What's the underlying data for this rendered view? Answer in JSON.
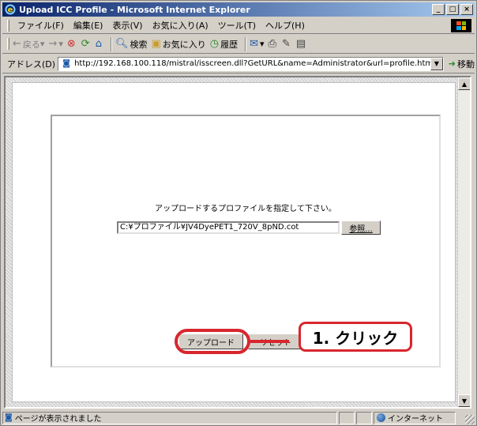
{
  "window": {
    "title": "Upload ICC Profile - Microsoft Internet Explorer",
    "controls": {
      "minimize": "_",
      "maximize": "□",
      "close": "×"
    }
  },
  "menu": [
    "ファイル(F)",
    "編集(E)",
    "表示(V)",
    "お気に入り(A)",
    "ツール(T)",
    "ヘルプ(H)"
  ],
  "toolbar": {
    "back": "戻る",
    "search": "検索",
    "favorites": "お気に入り",
    "history": "履歴"
  },
  "address": {
    "label": "アドレス(D)",
    "url": "http://192.168.100.118/mistral/isscreen.dll?GetURL&name=Administrator&url=profile.htm",
    "go": "移動"
  },
  "form": {
    "prompt": "アップロードするプロファイルを指定して下さい。",
    "file_value": "C:¥プロファイル¥JV4DyePET1_720V_8pND.cot",
    "browse_label": "参照...",
    "upload_label": "アップロード",
    "reset_label": "リセット"
  },
  "annotation": {
    "callout_text": "1. クリック",
    "color": "#d8262e"
  },
  "status": {
    "message": "ページが表示されました",
    "zone": "インターネット"
  }
}
